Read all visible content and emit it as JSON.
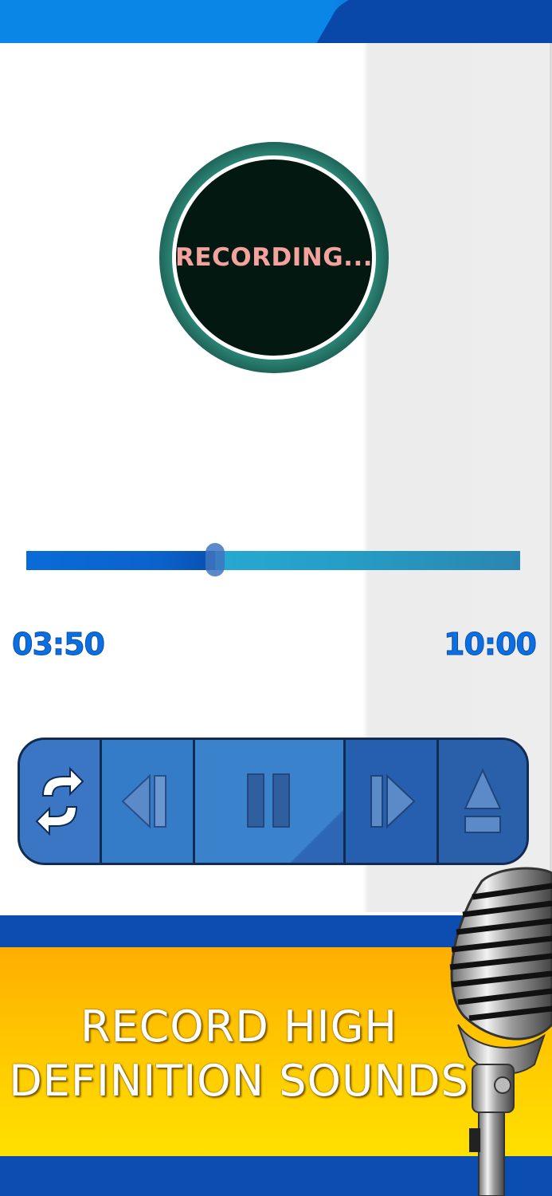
{
  "recorder": {
    "status_label": "RECORDING..."
  },
  "progress": {
    "elapsed": "03:50",
    "total": "10:00",
    "fraction": 0.383
  },
  "controls": [
    {
      "icon": "repeat-icon"
    },
    {
      "icon": "previous-icon"
    },
    {
      "icon": "pause-icon"
    },
    {
      "icon": "next-icon"
    },
    {
      "icon": "eject-icon"
    }
  ],
  "promo": {
    "line1": "RECORD HIGH",
    "line2": "DEFINITION SOUNDS"
  },
  "colors": {
    "accent": "#0b6fe0",
    "banner_yellow": "#ffc300",
    "dark_blue": "#0b4db1"
  }
}
